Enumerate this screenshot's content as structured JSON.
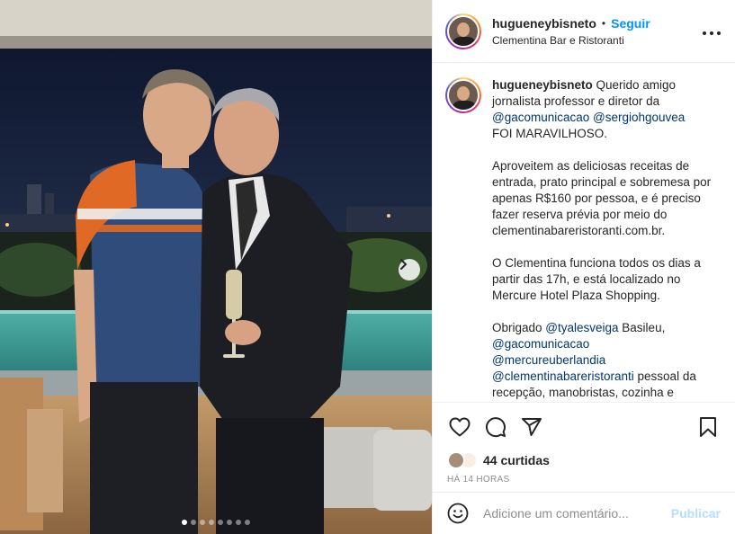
{
  "post": {
    "username": "hugueneybisneto",
    "separator": "•",
    "follow_label": "Seguir",
    "location": "Clementina Bar e Ristoranti",
    "more_icon": "more-horizontal-icon",
    "carousel": {
      "slide_count": 8,
      "active_index": 0,
      "next_icon": "chevron-right-icon"
    }
  },
  "caption": {
    "username": "hugueneybisneto",
    "line1_text": " Querido amigo jornalista professor e diretor da ",
    "mention1": "@gacomunicacao",
    "mention2": "@sergiohgouvea",
    "line1_end": "FOI MARAVILHOSO.",
    "para2": "Aproveitem as deliciosas receitas de entrada, prato principal e sobremesa por apenas R$160 por pessoa, e é preciso fazer reserva prévia por meio do clementinabareristoranti.com.br.",
    "para3": "O Clementina funciona todos os dias a partir das 17h, e está localizado no Mercure Hotel Plaza Shopping.",
    "para4_start": "Obrigado ",
    "mention3": "@tyalesveiga",
    "para4_mid": " Basileu,",
    "mention4": "@gacomunicacao",
    "mention5": "@mercureuberlandia",
    "mention6": "@clementinabareristoranti",
    "para4_end": " pessoal da recepção, manobristas, cozinha e"
  },
  "actions": {
    "icons": [
      "heart-icon",
      "comment-icon",
      "share-icon",
      "bookmark-icon"
    ],
    "likes_label": "44 curtidas",
    "time_label": "HÁ 14 HORAS"
  },
  "comment": {
    "emoji_icon": "emoji-icon",
    "placeholder": "Adicione um comentário...",
    "publish_label": "Publicar"
  },
  "colors": {
    "follow": "#0095f6",
    "mention": "#00376b",
    "publish_disabled": "#b2dffc",
    "muted": "#8e8e8e"
  }
}
